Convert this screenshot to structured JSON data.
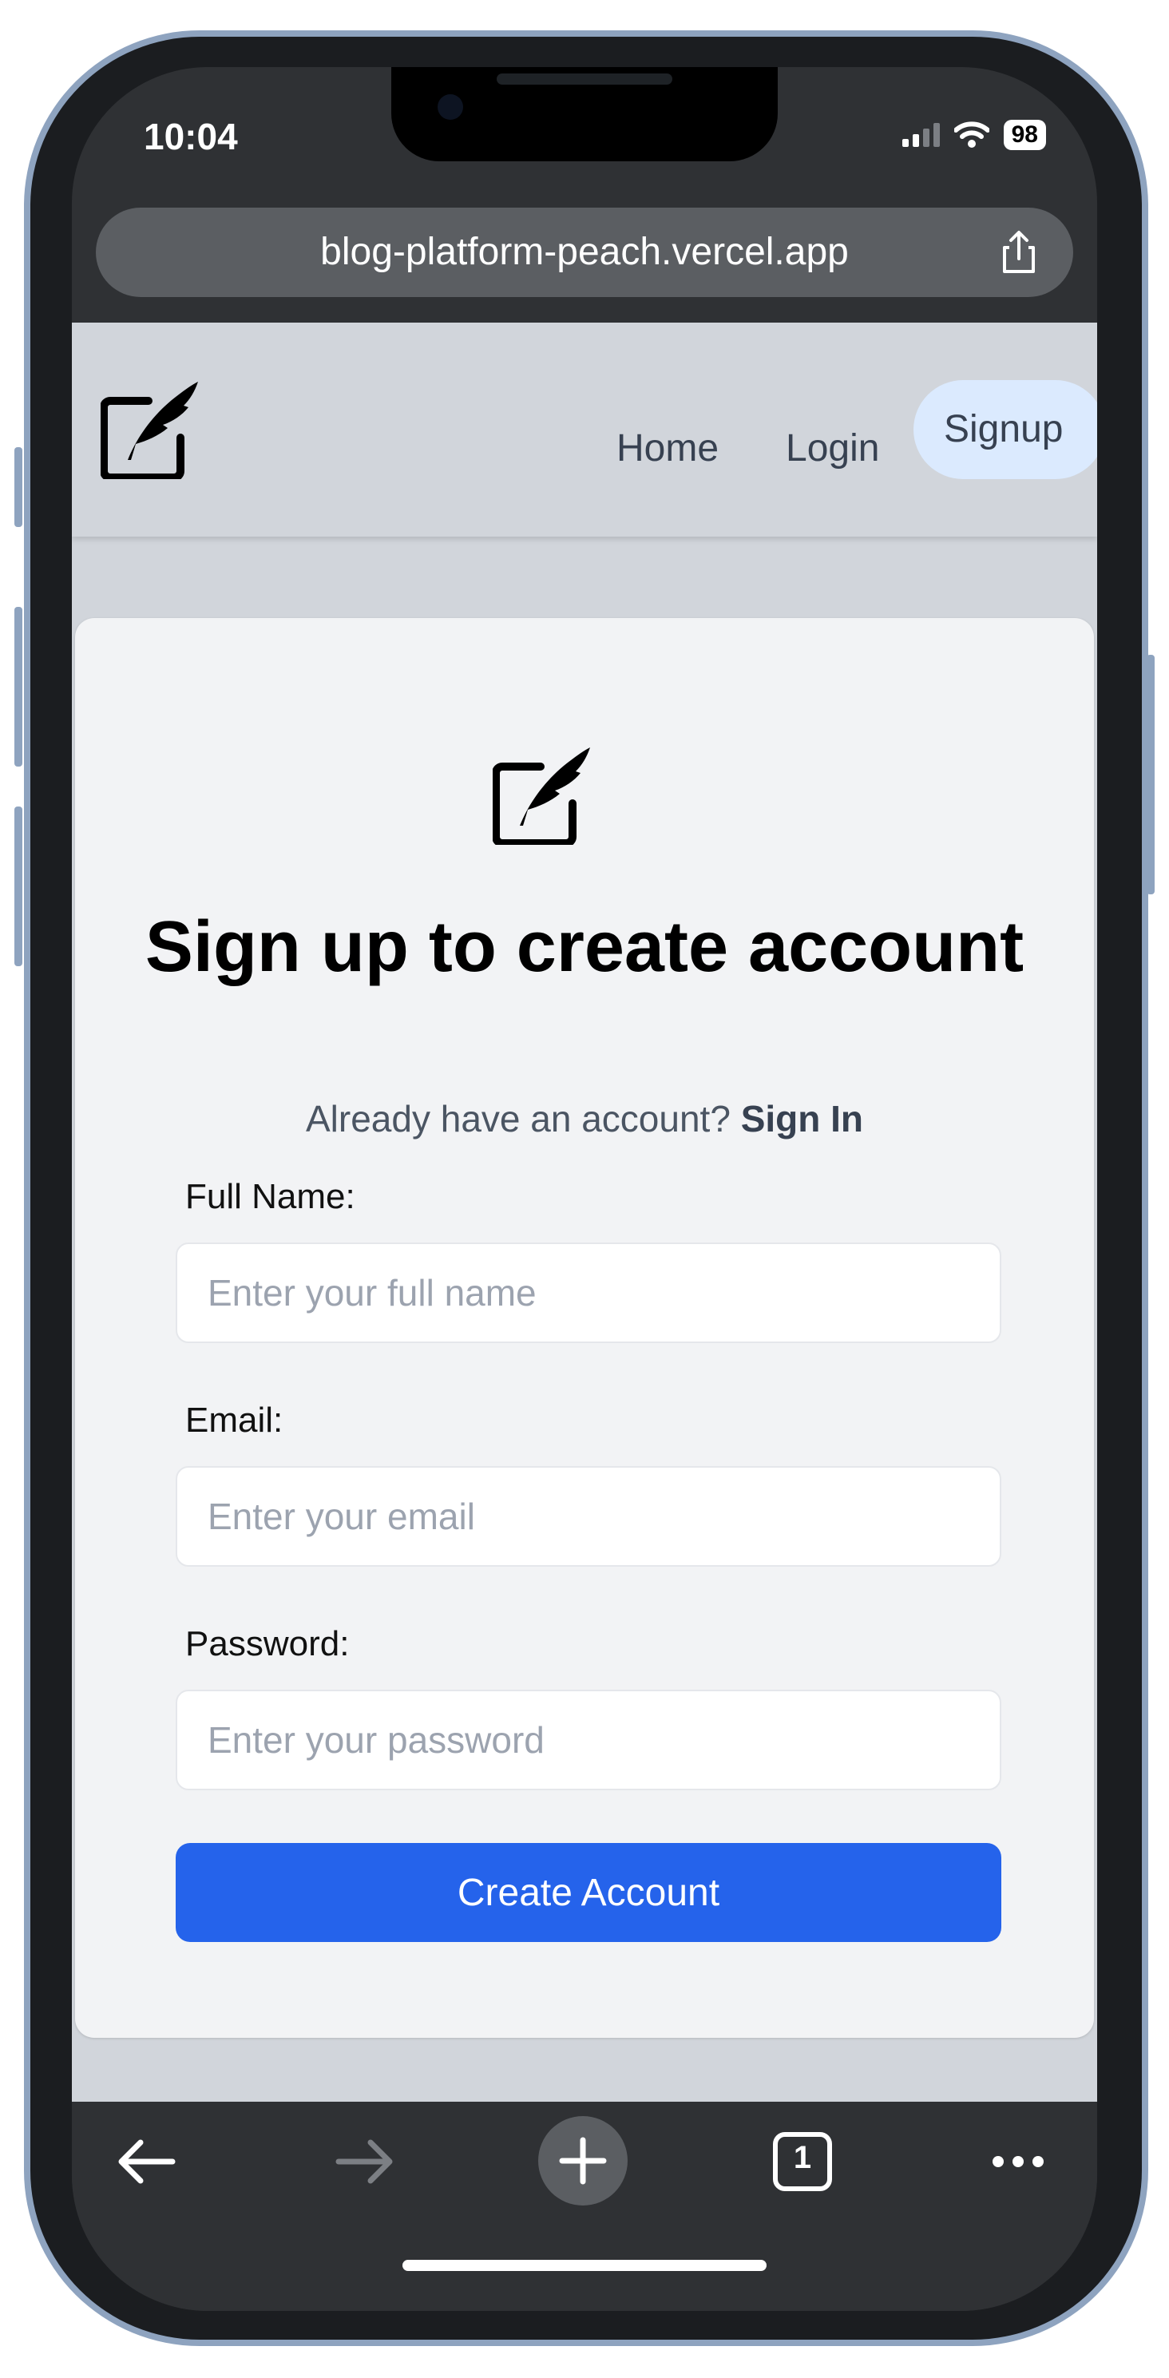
{
  "status_bar": {
    "time": "10:04",
    "battery": "98"
  },
  "browser": {
    "url": "blog-platform-peach.vercel.app",
    "tab_count": "1"
  },
  "nav": {
    "home": "Home",
    "login": "Login",
    "signup": "Signup"
  },
  "card": {
    "title": "Sign up to create account",
    "subtitle_prefix": "Already have an account?",
    "signin_link": "Sign In"
  },
  "form": {
    "fullname_label": "Full Name:",
    "fullname_placeholder": "Enter your full name",
    "email_label": "Email:",
    "email_placeholder": "Enter your email",
    "password_label": "Password:",
    "password_placeholder": "Enter your password",
    "submit": "Create Account"
  },
  "colors": {
    "accent": "#2563eb",
    "nav_active_bg": "#dbeafe",
    "page_bg": "#d1d5db"
  },
  "icons": [
    "signal-icon",
    "wifi-icon",
    "battery-icon",
    "share-icon",
    "quill-logo-icon",
    "back-arrow-icon",
    "forward-arrow-icon",
    "plus-icon",
    "tabs-icon",
    "more-icon"
  ]
}
